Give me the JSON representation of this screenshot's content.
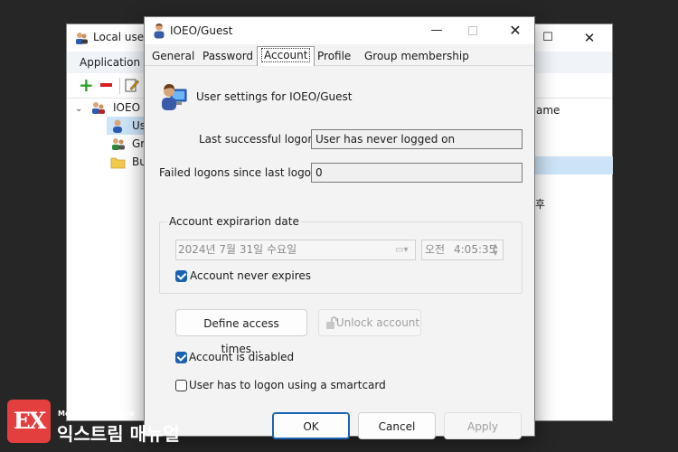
{
  "background_window": {
    "title": "Local users",
    "maximize_glyph": "☐",
    "close_glyph": "✕",
    "menu": {
      "application": "Application"
    },
    "tree": {
      "root_label": "IOEO (",
      "items": [
        "Us",
        "Gr",
        "Bu"
      ]
    },
    "list_header": "ame",
    "side_text": "후"
  },
  "dialog": {
    "title": "IOEO/Guest",
    "min_glyph": "—",
    "close_glyph": "✕",
    "tabs": [
      {
        "label": "General",
        "active": false
      },
      {
        "label": "Password",
        "active": false
      },
      {
        "label": "Account",
        "active": true
      },
      {
        "label": "Profile",
        "active": false
      },
      {
        "label": "Group membership",
        "active": false
      }
    ],
    "header_text": "User settings for IOEO/Guest",
    "last_logon_label": "Last successful logon:",
    "last_logon_value": "User has never logged on",
    "failed_logons_label": "Failed logons since last logon:",
    "failed_logons_value": "0",
    "expiration": {
      "group_title": "Account expirarion date",
      "date_value": "2024년   7월 31일 수요일",
      "time_ampm": "오전",
      "time_value": "4:05:35",
      "never_expires_label": "Account never expires",
      "never_expires_checked": true
    },
    "define_access_times_label": "Define access times...",
    "unlock_account_label": "Unlock account",
    "account_disabled_label": "Account is disabled",
    "account_disabled_checked": true,
    "smartcard_label": "User has to logon using a smartcard",
    "smartcard_checked": false,
    "ok_label": "OK",
    "cancel_label": "Cancel",
    "apply_label": "Apply"
  },
  "watermark": {
    "logo": "EX",
    "tagline": "More Better IT Life",
    "name": "익스트림 매뉴얼"
  },
  "colors": {
    "accent": "#1a62b0",
    "selection": "#cce4f7",
    "desktop": "#262626",
    "watermark_red": "#e43f3f"
  }
}
